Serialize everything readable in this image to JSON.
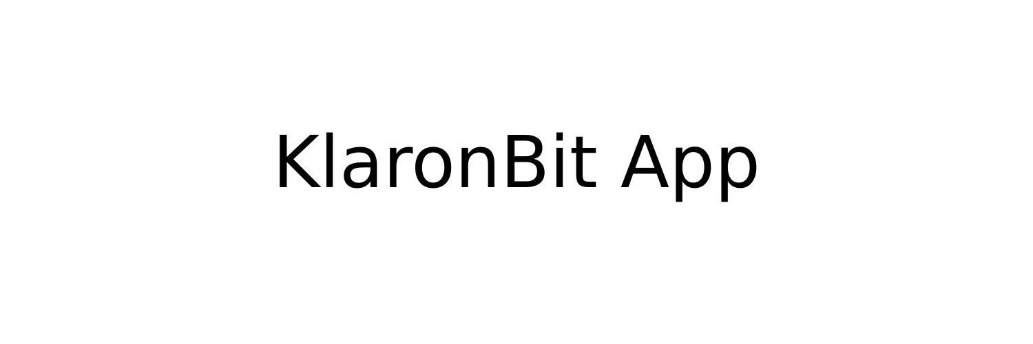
{
  "app": {
    "title": "KlaronBit App"
  },
  "colors": {
    "background": "#ffffff",
    "text": "#000000"
  }
}
